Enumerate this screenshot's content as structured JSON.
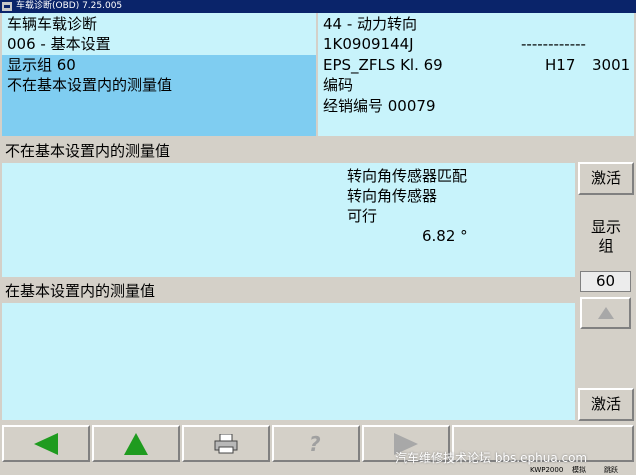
{
  "window": {
    "title": "车载诊断(OBD) 7.25.005"
  },
  "header": {
    "left": {
      "line1": "车辆车载诊断",
      "line2": "006 - 基本设置",
      "line3": "显示组 60",
      "line4": "不在基本设置内的测量值"
    },
    "right": {
      "line1": "44 - 动力转向",
      "part_number": "1K0909144J",
      "dashes": "------------",
      "component": "EPS_ZFLS Kl. 69",
      "version": "H17",
      "software": "3001",
      "coding_label": "编码",
      "dealer": "经销编号 00079"
    }
  },
  "section1": {
    "title": "不在基本设置内的测量值",
    "values": [
      "转向角传感器匹配",
      "转向角传感器",
      "可行",
      "6.82 °"
    ]
  },
  "section2": {
    "title": "在基本设置内的测量值"
  },
  "sidebar": {
    "activate_top": "激活",
    "group_label": "显示\n组",
    "group_number": "60",
    "activate_bottom": "激活"
  },
  "status": {
    "left": "KWP2000",
    "mid": "模拟",
    "right": "跳跃"
  },
  "watermark": "汽车维修技术论坛 bbs.ephua.com",
  "colors": {
    "panel": "#c8f3fb",
    "selected": "#7fcdf1",
    "title_bar": "#0a246a",
    "arrow_green": "#1f9b1f"
  },
  "toolbar_icons": [
    "back-arrow-icon",
    "up-arrow-icon",
    "print-icon",
    "help-icon",
    "forward-arrow-icon"
  ]
}
